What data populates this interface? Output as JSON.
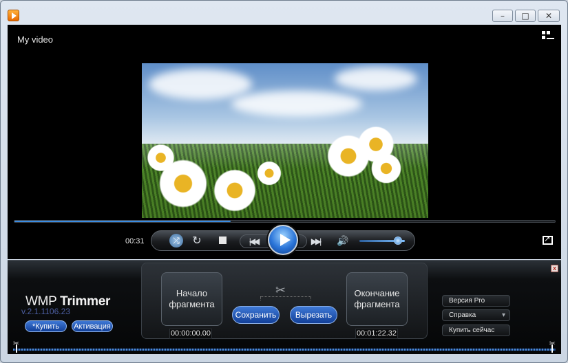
{
  "window": {
    "minimize_icon": "minimize-icon",
    "maximize_icon": "maximize-icon",
    "close_icon": "close-icon",
    "minimize_glyph": "–",
    "maximize_glyph": "□",
    "close_glyph": "✕"
  },
  "player": {
    "title": "My video",
    "current_time": "00:31",
    "progress_fraction": 0.4,
    "volume_fraction": 0.85
  },
  "trimmer": {
    "brand_light": "WMP ",
    "brand_bold": "Trimmer",
    "version": "v.2.1.1106.23",
    "buy_label": "*Купить",
    "activate_label": "Активация",
    "start_label_line1": "Начало",
    "start_label_line2": "фрагмента",
    "end_label_line1": "Окончание",
    "end_label_line2": "фрагмента",
    "start_time": "00:00:00.00",
    "end_time": "00:01:22.32",
    "save_label": "Сохранить",
    "cut_label": "Вырезать",
    "pro_label": "Версия Pro",
    "help_label": "Справка",
    "buy_now_label": "Купить сейчас",
    "close_glyph": "x"
  }
}
